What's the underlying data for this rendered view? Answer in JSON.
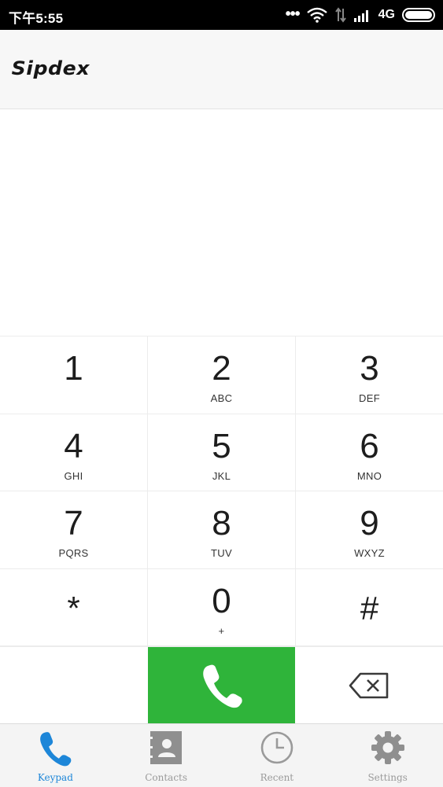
{
  "status_bar": {
    "time": "下午5:55",
    "dots": "•••",
    "network_type": "4G"
  },
  "header": {
    "logo_text": "Sipdex"
  },
  "keypad": {
    "keys": [
      {
        "digit": "1",
        "letters": ""
      },
      {
        "digit": "2",
        "letters": "ABC"
      },
      {
        "digit": "3",
        "letters": "DEF"
      },
      {
        "digit": "4",
        "letters": "GHI"
      },
      {
        "digit": "5",
        "letters": "JKL"
      },
      {
        "digit": "6",
        "letters": "MNO"
      },
      {
        "digit": "7",
        "letters": "PQRS"
      },
      {
        "digit": "8",
        "letters": "TUV"
      },
      {
        "digit": "9",
        "letters": "WXYZ"
      },
      {
        "digit": "*",
        "letters": ""
      },
      {
        "digit": "0",
        "letters": "+"
      },
      {
        "digit": "#",
        "letters": ""
      }
    ]
  },
  "actions": {
    "call_icon": "phone-icon",
    "backspace_icon": "backspace-icon"
  },
  "tabs": [
    {
      "label": "Keypad",
      "icon": "phone-icon",
      "active": true
    },
    {
      "label": "Contacts",
      "icon": "contacts-icon",
      "active": false
    },
    {
      "label": "Recent",
      "icon": "clock-icon",
      "active": false
    },
    {
      "label": "Settings",
      "icon": "gear-icon",
      "active": false
    }
  ],
  "colors": {
    "call_green": "#2fb43a",
    "active_tab_blue": "#1d86d8",
    "inactive_tab_gray": "#9a9a9a",
    "status_bar": "#000000"
  }
}
